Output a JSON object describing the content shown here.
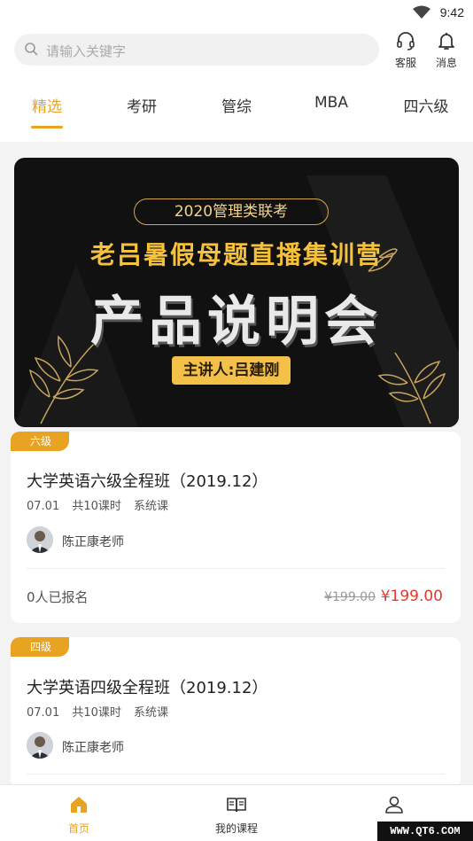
{
  "status_bar": {
    "time": "9:42"
  },
  "header": {
    "search_placeholder": "请输入关键字",
    "service_label": "客服",
    "message_label": "消息"
  },
  "tabs": [
    {
      "label": "精选",
      "active": true
    },
    {
      "label": "考研",
      "active": false
    },
    {
      "label": "管综",
      "active": false
    },
    {
      "label": "MBA",
      "active": false
    },
    {
      "label": "四六级",
      "active": false
    }
  ],
  "banner": {
    "pill": "2020管理类联考",
    "subtitle": "老吕暑假母题直播集训营",
    "title": "产品说明会",
    "speaker": "主讲人:吕建刚"
  },
  "courses": [
    {
      "badge": "六级",
      "title": "大学英语六级全程班（2019.12）",
      "date": "07.01",
      "lessons": "共10课时",
      "type": "系统课",
      "teacher": "陈正康老师",
      "enrolled": "0人已报名",
      "original_price": "¥199.00",
      "price": "¥199.00"
    },
    {
      "badge": "四级",
      "title": "大学英语四级全程班（2019.12）",
      "date": "07.01",
      "lessons": "共10课时",
      "type": "系统课",
      "teacher": "陈正康老师"
    }
  ],
  "bottom_nav": [
    {
      "label": "首页",
      "icon": "home-icon",
      "active": true
    },
    {
      "label": "我的课程",
      "icon": "book-icon",
      "active": false
    },
    {
      "label": "",
      "icon": "user-icon",
      "active": false
    }
  ],
  "watermark": "WWW.QT6.COM",
  "colors": {
    "accent": "#e8a322",
    "price": "#e03a2f",
    "banner_gold": "#f6c13b"
  }
}
